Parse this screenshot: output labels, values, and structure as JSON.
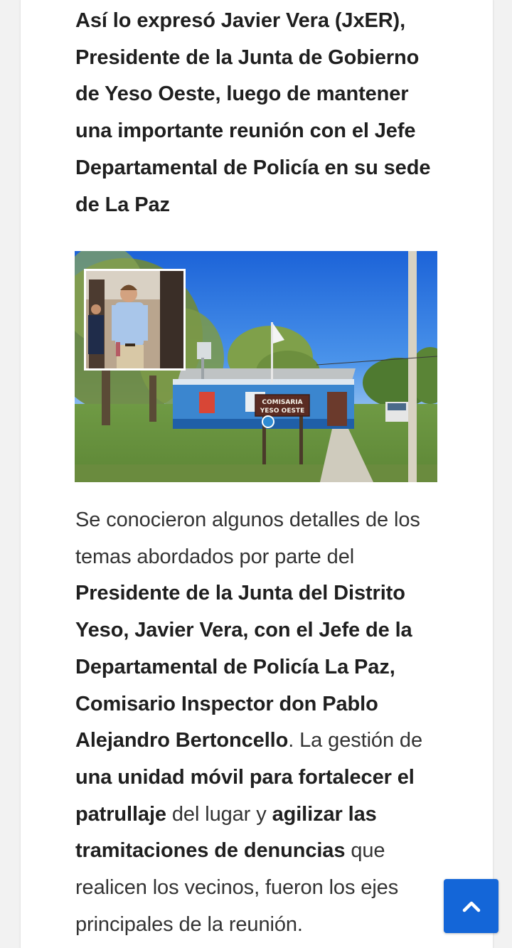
{
  "article": {
    "lead": "Así lo expresó Javier Vera (JxER), Presidente de la Junta de Gobierno de Yeso Oeste, luego de mantener una importante reunión con el Jefe Departamental de Policía en su sede de La Paz",
    "image": {
      "sign_line1": "COMISARIA",
      "sign_line2": "YESO OESTE"
    },
    "body": {
      "p1": "Se conocieron algunos detalles de los temas abordados por parte del ",
      "b1": "Presidente de la Junta del Distrito Yeso, Javier Vera, con el Jefe de la Departamental de Policía La Paz, Comisario Inspector don Pablo Alejandro Bertoncello",
      "p2": ". La gestión de ",
      "b2": "una unidad móvil para fortalecer el patrullaje",
      "p3": " del lugar y ",
      "b3": "agilizar las tramitaciones de denuncias",
      "p4": " que realicen los vecinos, fueron los ejes principales de la reunión."
    }
  },
  "ui": {
    "back_to_top_icon": "chevron-up-icon",
    "accent": "#1466d8"
  }
}
